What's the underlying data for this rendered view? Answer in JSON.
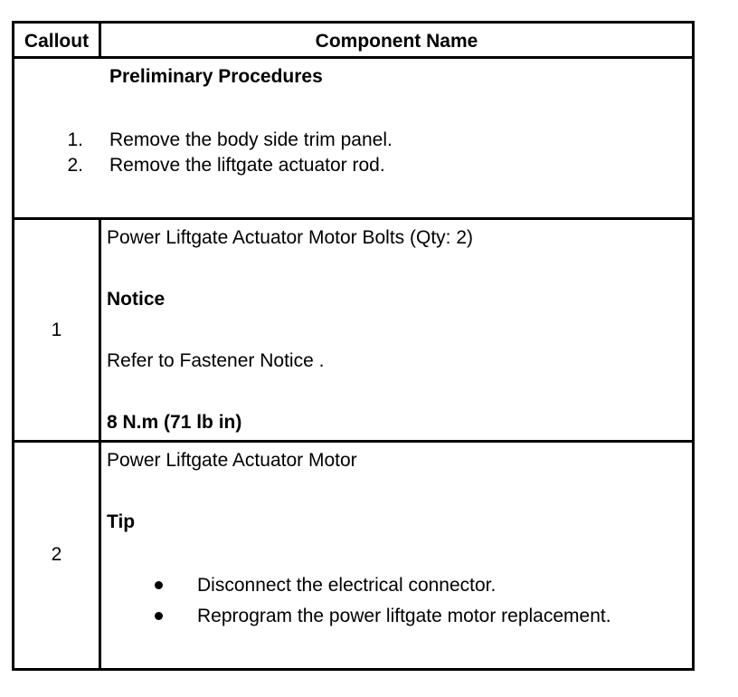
{
  "header": {
    "callout": "Callout",
    "component_name": "Component Name"
  },
  "preliminary": {
    "title": "Preliminary Procedures",
    "steps": [
      {
        "num": "1.",
        "text": "Remove the body side trim panel."
      },
      {
        "num": "2.",
        "text": "Remove the liftgate actuator rod."
      }
    ]
  },
  "rows": [
    {
      "callout": "1",
      "component": "Power Liftgate Actuator Motor Bolts (Qty: 2)",
      "note_title": "Notice",
      "note_text": "Refer to Fastener Notice .",
      "spec": "8 N.m (71 lb in)"
    },
    {
      "callout": "2",
      "component": "Power Liftgate Actuator Motor",
      "note_title": "Tip",
      "bullets": [
        "Disconnect the electrical connector.",
        "Reprogram the power liftgate motor replacement."
      ]
    }
  ]
}
